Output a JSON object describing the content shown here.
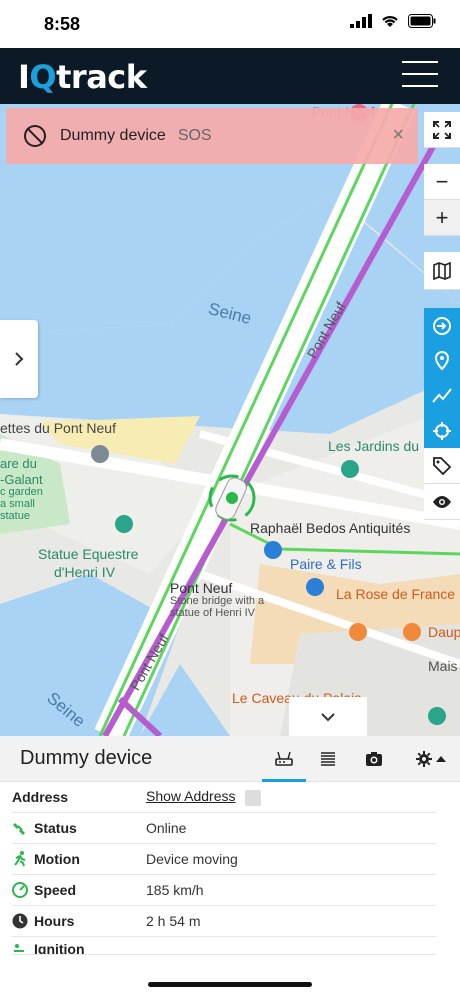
{
  "status_bar": {
    "time": "8:58"
  },
  "header": {
    "logo_prefix": "I",
    "logo_q": "Q",
    "logo_suffix": "track"
  },
  "alert": {
    "device": "Dummy device",
    "type": "SOS",
    "close": "×"
  },
  "map": {
    "labels": {
      "seine_top": "Seine",
      "seine_bottom": "Seine",
      "pont_neuf_road": "Pont Neuf",
      "pont_neuf_road2": "Pont Neuf",
      "pont_neuf_place": "Pont Neuf",
      "pont_neuf_desc1": "Stone bridge with a",
      "pont_neuf_desc2": "statue of Henri IV",
      "ettes": "ettes du Pont Neuf",
      "jardins": "Les Jardins du",
      "statue1": "Statue Equestre",
      "statue2": "d'Henri IV",
      "bedos": "Raphaël Bedos Antiquités",
      "paire": "Paire & Fils",
      "rose": "La Rose de France",
      "daup": "Daup",
      "mais": "Mais",
      "caveau": "Le Caveau du Palais",
      "vert1": "are du",
      "vert2": "-Galant",
      "vert3": "c garden",
      "vert4": "a small",
      "vert5": "statue",
      "top_road": "Pont Neuf"
    }
  },
  "controls": {
    "fullscreen_icon": "fullscreen-icon",
    "zoom_out": "−",
    "zoom_in": "+"
  },
  "panel": {
    "title": "Dummy device",
    "rows": [
      {
        "label": "Address",
        "value": "Show Address"
      },
      {
        "label": "Status",
        "value": "Online"
      },
      {
        "label": "Motion",
        "value": "Device moving"
      },
      {
        "label": "Speed",
        "value": "185 km/h"
      },
      {
        "label": "Hours",
        "value": "2 h 54 m"
      },
      {
        "label": "Ignition",
        "value": ""
      }
    ]
  },
  "colors": {
    "accent": "#1a9fe0",
    "header": "#0b1a26",
    "alert": "#f6aaaa",
    "route": "#b45cd0",
    "water": "#a9d3f5"
  }
}
